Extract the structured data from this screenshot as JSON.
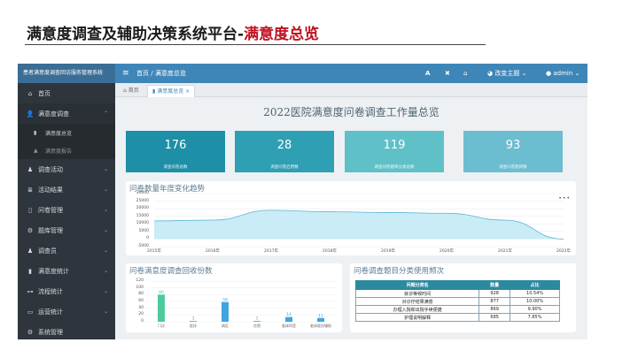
{
  "slide": {
    "title_main": "满意度调查及辅助决策系统平台-",
    "title_accent": "满意度总览"
  },
  "sidebar": {
    "brand": "患者满意度调查回访服务管理系统",
    "items": [
      {
        "icon": "home-icon",
        "glyph": "⌂",
        "label": "首页",
        "chevron": ""
      },
      {
        "icon": "user-survey-icon",
        "glyph": "👤",
        "label": "满意度调查",
        "chevron": "⌃"
      },
      {
        "icon": "user-check-icon",
        "glyph": "♟",
        "label": "调查活动",
        "chevron": "⌄"
      },
      {
        "icon": "list-icon",
        "glyph": "≣",
        "label": "活动结果",
        "chevron": "⌄"
      },
      {
        "icon": "book-icon",
        "glyph": "▯",
        "label": "问卷管理",
        "chevron": "⌄"
      },
      {
        "icon": "gear-icon",
        "glyph": "⚙",
        "label": "题库管理",
        "chevron": "⌄"
      },
      {
        "icon": "users-icon",
        "glyph": "♟",
        "label": "调查员",
        "chevron": "⌄"
      },
      {
        "icon": "bar-chart-icon",
        "glyph": "▮",
        "label": "满意度统计",
        "chevron": "⌄"
      },
      {
        "icon": "sitemap-icon",
        "glyph": "⊶",
        "label": "流程统计",
        "chevron": "⌄"
      },
      {
        "icon": "desktop-icon",
        "glyph": "▭",
        "label": "运营统计",
        "chevron": "⌄"
      },
      {
        "icon": "gear-icon",
        "glyph": "⚙",
        "label": "系统管理",
        "chevron": ""
      }
    ],
    "sub_items": [
      {
        "label": "满意度总览"
      },
      {
        "label": "满意度报告"
      }
    ]
  },
  "topbar": {
    "menu_icon": "≡",
    "breadcrumb_home": "首页",
    "breadcrumb_sep": "/",
    "breadcrumb_current": "满意度总览",
    "font_icon": "A",
    "expand_icon": "✖",
    "home_icon": "⌂",
    "theme_label": "改变主题 ⌄",
    "user_label": "admin ⌄"
  },
  "tabs": [
    {
      "label": "首页"
    },
    {
      "label": "满意度总览 ×"
    }
  ],
  "main": {
    "heading": "2022医院满意度问卷调查工作量总览",
    "stats": [
      {
        "value": "176",
        "label": "调查问卷总数",
        "color": "#1d8fa6"
      },
      {
        "value": "28",
        "label": "调查问卷启用数",
        "color": "#2f9fb4"
      },
      {
        "value": "119",
        "label": "调查问卷题目分类总数",
        "color": "#5fc0c8"
      },
      {
        "value": "93",
        "label": "调查问卷题目数",
        "color": "#6cbdd0"
      }
    ]
  },
  "trend": {
    "title": "问卷数量年度变化趋势",
    "more": "•••"
  },
  "recovery": {
    "title": "问卷满意度调查回收份数"
  },
  "category": {
    "title": "问卷调查题目分类使用频次",
    "headers": [
      "问题分类名",
      "数量",
      "占比"
    ],
    "rows": [
      [
        "就诊等候时间",
        "928",
        "10.54%"
      ],
      [
        "对诊疗结果满意",
        "877",
        "10.00%"
      ],
      [
        "办理入院和出院手续便捷",
        "869",
        "9.90%"
      ],
      [
        "护理说明解释",
        "685",
        "7.85%"
      ]
    ]
  },
  "chart_data": [
    {
      "type": "area",
      "title": "问卷数量年度变化趋势",
      "x": [
        "2015年",
        "2016年",
        "2017年",
        "2018年",
        "2019年",
        "2020年",
        "2021年",
        "2022年"
      ],
      "series": [
        {
          "values": [
            12000,
            12500,
            19000,
            18000,
            17500,
            17000,
            12500,
            0
          ]
        }
      ],
      "yticks": [
        30000,
        25000,
        20000,
        15000,
        10000,
        5000,
        0,
        -5000
      ],
      "ylim": [
        -5000,
        30000
      ],
      "color": "#5ab4d6",
      "fill": "#c9ecf6"
    },
    {
      "type": "bar",
      "title": "问卷满意度调查回收份数",
      "categories": [
        "门诊",
        "医技",
        "病区",
        "住院",
        "临床科室",
        "临床医技辅助"
      ],
      "values": [
        80,
        1,
        58,
        1,
        14,
        11
      ],
      "yticks": [
        120,
        100,
        80,
        60,
        40,
        20,
        0
      ],
      "ylim": [
        0,
        120
      ],
      "colors": [
        "#4ecb9c",
        "#3fa5e0",
        "#3fa5e0",
        "#3fa5e0",
        "#3fa5e0",
        "#3fa5e0"
      ]
    }
  ]
}
